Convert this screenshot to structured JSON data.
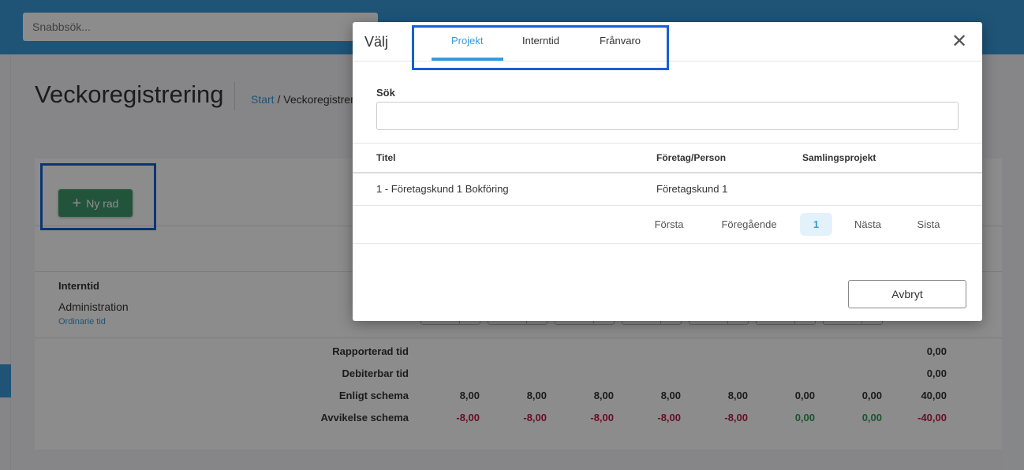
{
  "header": {
    "quick_search_placeholder": "Snabbsök..."
  },
  "page": {
    "title": "Veckoregistrering",
    "breadcrumb_home": "Start",
    "breadcrumb_sep": "/",
    "breadcrumb_current": "Veckoregistrer"
  },
  "toolbar": {
    "new_row_label": "Ny rad"
  },
  "rows": {
    "group_title": "Interntid",
    "row_title": "Administration",
    "row_subtitle": "Ordinarie tid"
  },
  "summary": {
    "labels": [
      "Rapporterad tid",
      "Debiterbar tid",
      "Enligt schema",
      "Avvikelse schema"
    ],
    "rapporterad_total": "0,00",
    "debiterbar_total": "0,00",
    "enligt_schema": [
      "8,00",
      "8,00",
      "8,00",
      "8,00",
      "8,00",
      "0,00",
      "0,00",
      "40,00"
    ],
    "avvikelse_schema": [
      "-8,00",
      "-8,00",
      "-8,00",
      "-8,00",
      "-8,00",
      "0,00",
      "0,00",
      "-40,00"
    ]
  },
  "modal": {
    "title": "Välj",
    "tabs": [
      "Projekt",
      "Interntid",
      "Frånvaro"
    ],
    "active_tab": "Projekt",
    "close_icon": "close-icon",
    "search_label": "Sök",
    "search_value": "",
    "columns": [
      "Titel",
      "Företag/Person",
      "Samlingsprojekt"
    ],
    "rows": [
      {
        "titel": "1 - Företagskund 1 Bokföring",
        "foretag": "Företagskund 1",
        "samlingsprojekt": ""
      }
    ],
    "pagination": {
      "first": "Första",
      "prev": "Föregående",
      "current": "1",
      "next": "Nästa",
      "last": "Sista"
    },
    "cancel_label": "Avbryt"
  },
  "colors": {
    "accent": "#3a9ad9",
    "primary_button": "#3e9a6e",
    "highlight_box": "#1560d8",
    "negative": "#c0194b",
    "positive": "#2f9b58"
  }
}
